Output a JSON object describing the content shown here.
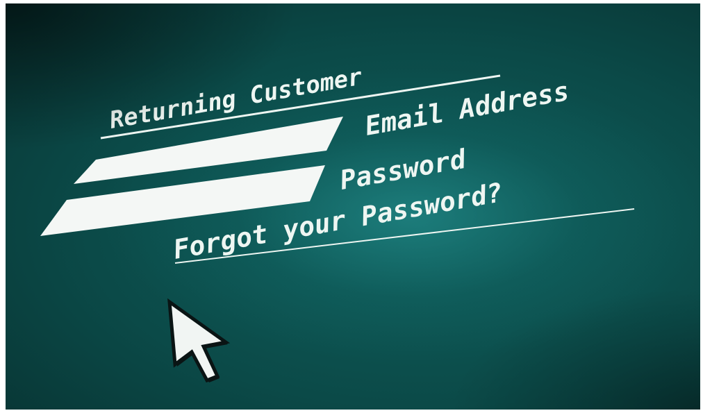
{
  "form": {
    "heading": "Returning Customer",
    "email_label": "Email Address",
    "password_label": "Password",
    "email_value": "",
    "password_value": "",
    "forgot_link": "Forgot your Password?"
  },
  "cursor": {
    "icon": "arrow-pointer-icon"
  },
  "colors": {
    "screen_bg": "#0b4a48",
    "text": "#eef6f2",
    "field": "#f4f7f5"
  }
}
